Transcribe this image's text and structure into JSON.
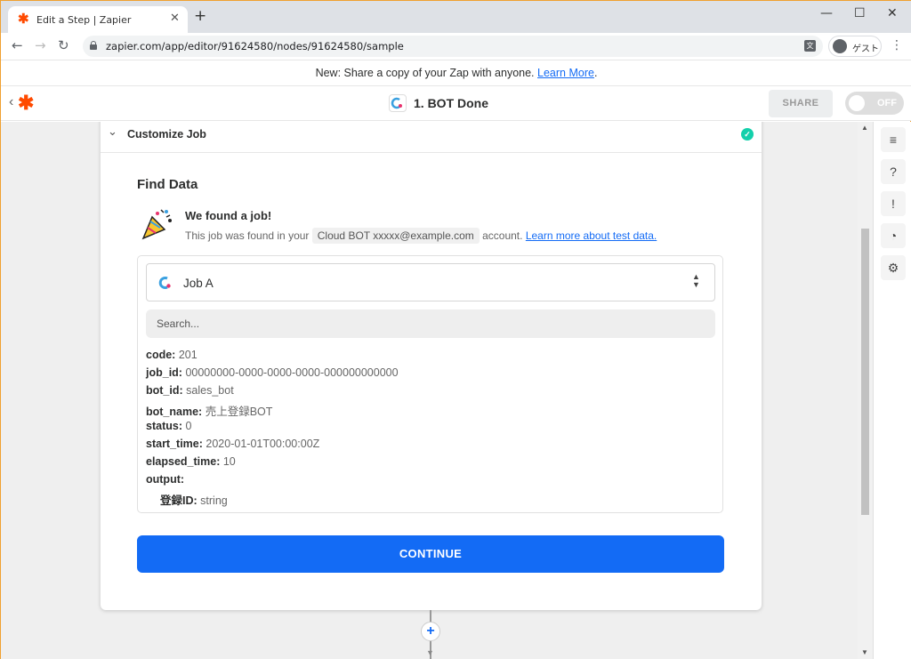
{
  "browser": {
    "tab_title": "Edit a Step | Zapier",
    "new_tab": "+",
    "url": "zapier.com/app/editor/91624580/nodes/91624580/sample",
    "profile_name": "ゲスト"
  },
  "banner": {
    "text": "New: Share a copy of your Zap with anyone. ",
    "link": "Learn More",
    "suffix": "."
  },
  "header": {
    "step_title": "1. BOT Done",
    "share_label": "SHARE",
    "toggle_label": "OFF"
  },
  "card": {
    "section_title": "Customize Job",
    "find_data_title": "Find Data",
    "found_title": "We found a job!",
    "found_prefix": "This job was found in your",
    "account_name": "Cloud BOT xxxxx@example.com",
    "found_suffix": "account.",
    "learn_more": "Learn more about test data.",
    "selected_job": "Job A",
    "search_placeholder": "Search...",
    "fields": [
      {
        "key": "code:",
        "value": "201"
      },
      {
        "key": "job_id:",
        "value": "00000000-0000-0000-0000-000000000000"
      },
      {
        "key": "bot_id:",
        "value": "sales_bot"
      },
      {
        "key": "bot_name:",
        "value": "売上登録BOT"
      },
      {
        "key": "status:",
        "value": "0"
      },
      {
        "key": "start_time:",
        "value": "2020-01-01T00:00:00Z"
      },
      {
        "key": "elapsed_time:",
        "value": "10"
      },
      {
        "key": "output:",
        "value": ""
      },
      {
        "key": "登録ID:",
        "value": "string"
      }
    ],
    "continue_label": "CONTINUE"
  },
  "colors": {
    "brand": "#ff4a00",
    "primary": "#136bf5",
    "success": "#13d0ab"
  }
}
